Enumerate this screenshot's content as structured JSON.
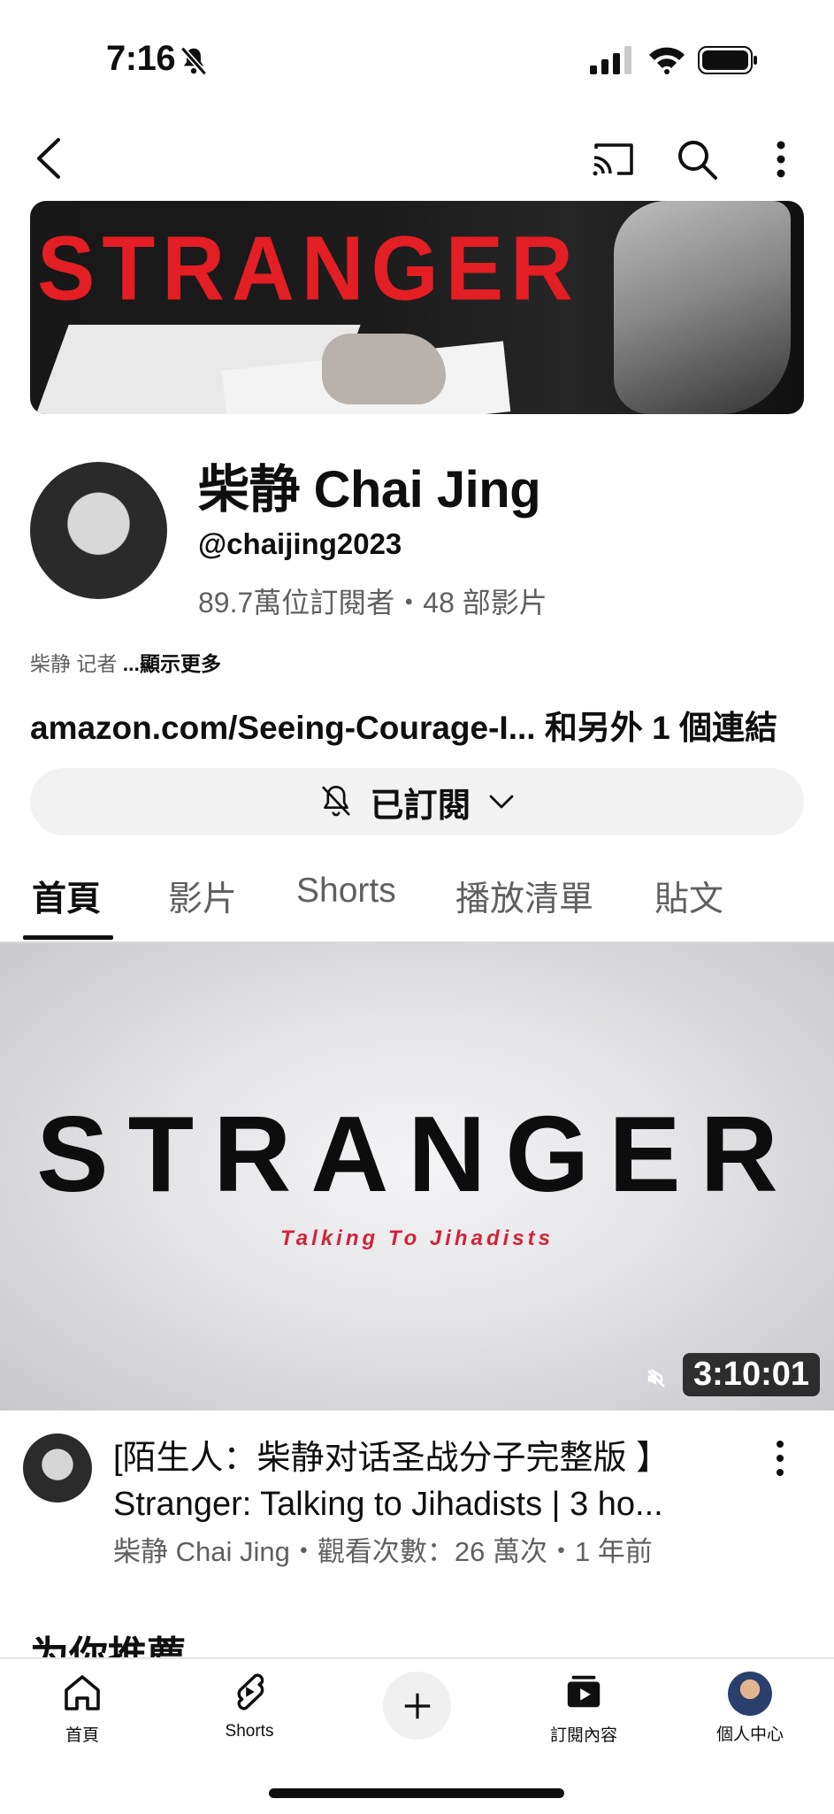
{
  "status_bar": {
    "time": "7:16"
  },
  "banner": {
    "title": "STRANGER"
  },
  "channel": {
    "name": "柴静 Chai Jing",
    "handle": "@chaijing2023",
    "stats": "89.7萬位訂閱者・48 部影片",
    "description_prefix": "柴静 记者 ",
    "description_more": "...顯示更多",
    "link_text": "amazon.com/Seeing-Courage-I... 和另外 1 個連結",
    "subscribe_label": "已訂閱"
  },
  "tabs": [
    {
      "label": "首頁",
      "active": true
    },
    {
      "label": "影片"
    },
    {
      "label": "Shorts"
    },
    {
      "label": "播放清單"
    },
    {
      "label": "貼文"
    }
  ],
  "featured_video": {
    "thumb_title": "STRANGER",
    "thumb_subtitle": "Talking To Jihadists",
    "duration": "3:10:01",
    "title_line1": "[陌生人：柴静对话圣战分子完整版 】",
    "title_line2": "Stranger: Talking to Jihadists | 3 ho...",
    "meta": "柴静 Chai Jing・觀看次數：26 萬次・1 年前"
  },
  "next_section": {
    "title": "为你推薦"
  },
  "bottom_nav": {
    "items": [
      {
        "label": "首頁",
        "icon": "home-icon"
      },
      {
        "label": "Shorts",
        "icon": "shorts-icon"
      },
      {
        "label": "",
        "icon": "plus-icon"
      },
      {
        "label": "訂閱內容",
        "icon": "subscriptions-icon"
      },
      {
        "label": "個人中心",
        "icon": "profile-avatar"
      }
    ]
  }
}
